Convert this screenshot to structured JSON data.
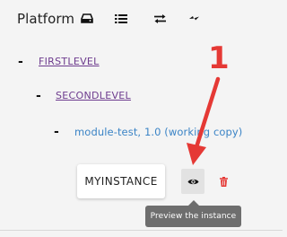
{
  "header": {
    "title": "Platform",
    "icons": [
      "drive-icon",
      "list-icon",
      "swap-icon",
      "bolt-icon"
    ]
  },
  "tree": {
    "level1": {
      "label": "FIRSTLEVEL"
    },
    "level2": {
      "label": "SECONDLEVEL"
    },
    "module": {
      "label": "module-test, 1.0 (working copy)"
    }
  },
  "instance": {
    "label": "MYINSTANCE",
    "preview_icon": "eye-icon",
    "delete_icon": "trash-icon"
  },
  "tooltip": {
    "text": "Preview the instance"
  },
  "annotation": {
    "number": "1",
    "color": "#e53935"
  },
  "colors": {
    "tree_link": "#6d3b8e",
    "module_link": "#3b84c6",
    "delete": "#e53935",
    "tooltip_bg": "#6e6e6e"
  }
}
